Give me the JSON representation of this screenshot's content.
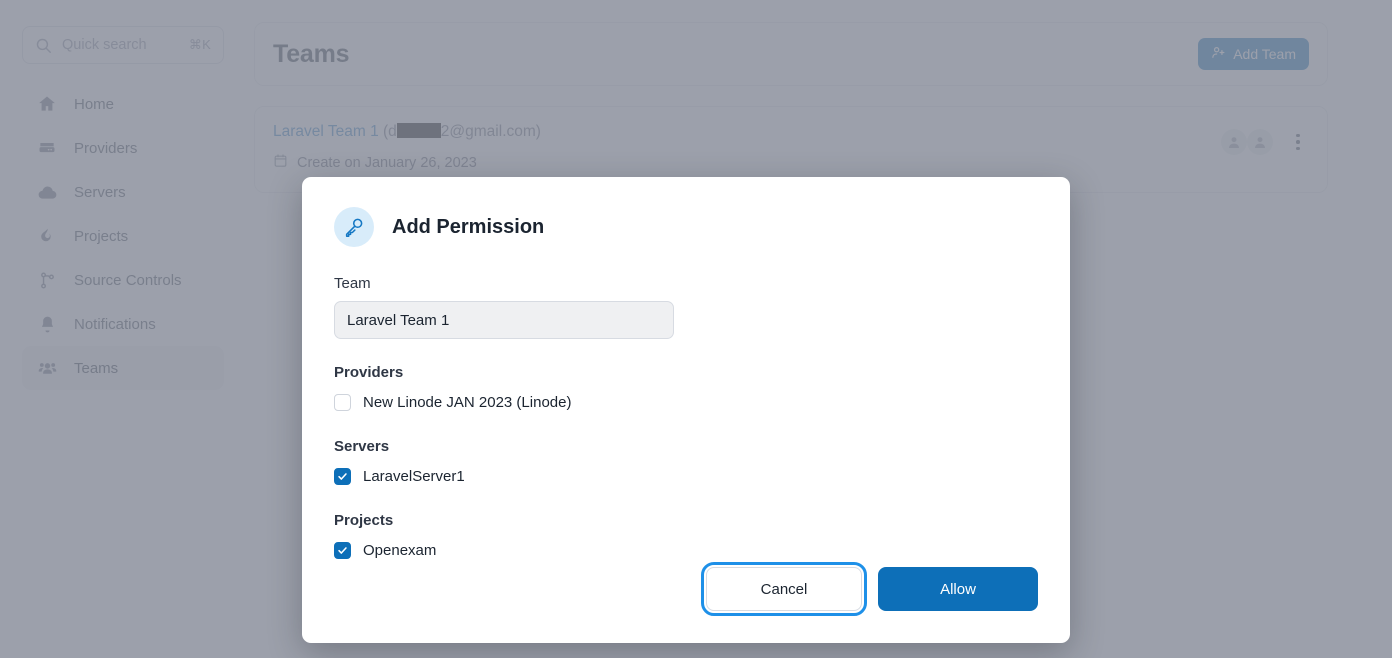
{
  "sidebar": {
    "search": {
      "placeholder": "Quick search",
      "shortcut": "⌘K"
    },
    "items": [
      {
        "label": "Home",
        "icon": "home-icon"
      },
      {
        "label": "Providers",
        "icon": "server-stack-icon"
      },
      {
        "label": "Servers",
        "icon": "cloud-icon"
      },
      {
        "label": "Projects",
        "icon": "flame-icon"
      },
      {
        "label": "Source Controls",
        "icon": "git-branch-icon"
      },
      {
        "label": "Notifications",
        "icon": "bell-icon"
      },
      {
        "label": "Teams",
        "icon": "users-icon"
      }
    ],
    "active_index": 6
  },
  "main": {
    "page_title": "Teams",
    "add_team_label": "Add Team",
    "team": {
      "name": "Laravel Team 1",
      "email_prefix": " (d",
      "email_suffix": "2@gmail.com)",
      "created_text": "Create on January 26, 2023"
    }
  },
  "modal": {
    "title": "Add Permission",
    "icon": "key-icon",
    "team_field": {
      "label": "Team",
      "value": "Laravel Team 1"
    },
    "groups": [
      {
        "label": "Providers",
        "options": [
          {
            "label": "New Linode JAN 2023 (Linode)",
            "checked": false
          }
        ]
      },
      {
        "label": "Servers",
        "options": [
          {
            "label": "LaravelServer1",
            "checked": true
          }
        ]
      },
      {
        "label": "Projects",
        "options": [
          {
            "label": "Openexam",
            "checked": true
          }
        ]
      }
    ],
    "cancel_label": "Cancel",
    "allow_label": "Allow"
  },
  "colors": {
    "accent": "#0d6fb8",
    "focus_ring": "#1e90e8",
    "overlay": "#868b98",
    "link": "#2f7ec4",
    "badge_bg": "#d8ecfa"
  }
}
